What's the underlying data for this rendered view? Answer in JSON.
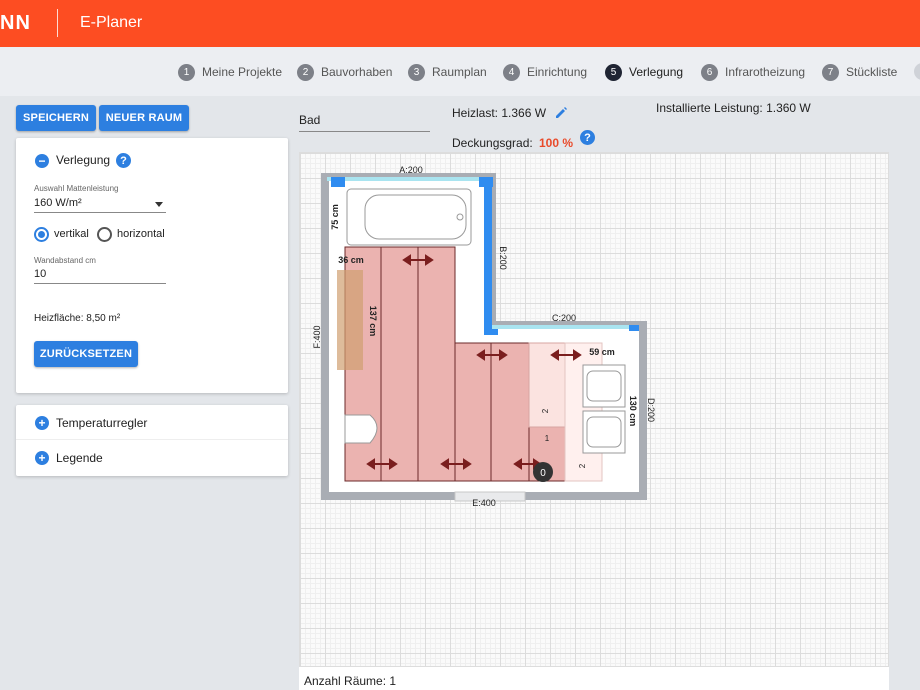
{
  "header": {
    "logo": "NN",
    "title": "E-Planer"
  },
  "steps": [
    {
      "num": "1",
      "label": "Meine Projekte"
    },
    {
      "num": "2",
      "label": "Bauvorhaben"
    },
    {
      "num": "3",
      "label": "Raumplan"
    },
    {
      "num": "4",
      "label": "Einrichtung"
    },
    {
      "num": "5",
      "label": "Verlegung",
      "active": true
    },
    {
      "num": "6",
      "label": "Infrarotheizung"
    },
    {
      "num": "7",
      "label": "Stückliste"
    }
  ],
  "toolbar": {
    "save_label": "SPEICHERN",
    "new_room_label": "NEUER RAUM"
  },
  "verlegung": {
    "title": "Verlegung",
    "help": "?",
    "matte_label": "Auswahl Mattenleistung",
    "matte_value": "160 W/m²",
    "vertical_label": "vertikal",
    "horizontal_label": "horizontal",
    "orientation": "vertikal",
    "wandabstand_label": "Wandabstand cm",
    "wandabstand_value": "10",
    "heizflaeche": "Heizfläche: 8,50 m²",
    "reset_label": "ZURÜCKSETZEN"
  },
  "accordion": {
    "temperatur": "Temperaturregler",
    "legende": "Legende"
  },
  "room": {
    "name": "Bad",
    "heizlast": "Heizlast: 1.366 W",
    "deckung_label": "Deckungsgrad:",
    "deckung_value": "100 %",
    "installiert": "Installierte Leistung: 1.360 W"
  },
  "plan": {
    "wall_labels": {
      "a": "A:200",
      "b": "B:200",
      "c": "C:200",
      "d": "D:200",
      "e": "E:400",
      "f": "F:400"
    },
    "dims": {
      "d75": "75 cm",
      "d36": "36 cm",
      "d137": "137 cm",
      "d59": "59 cm",
      "d130": "130 cm"
    },
    "small": {
      "n2a": "2",
      "n1": "1",
      "n2b": "2",
      "thermostat": "0"
    }
  },
  "colors": {
    "accent": "#2d7fe0",
    "header": "#fd4d22",
    "mat": "#e8a6a2",
    "wall_highlight": "#2f8cf0"
  },
  "footer": {
    "rooms": "Anzahl Räume: 1"
  }
}
